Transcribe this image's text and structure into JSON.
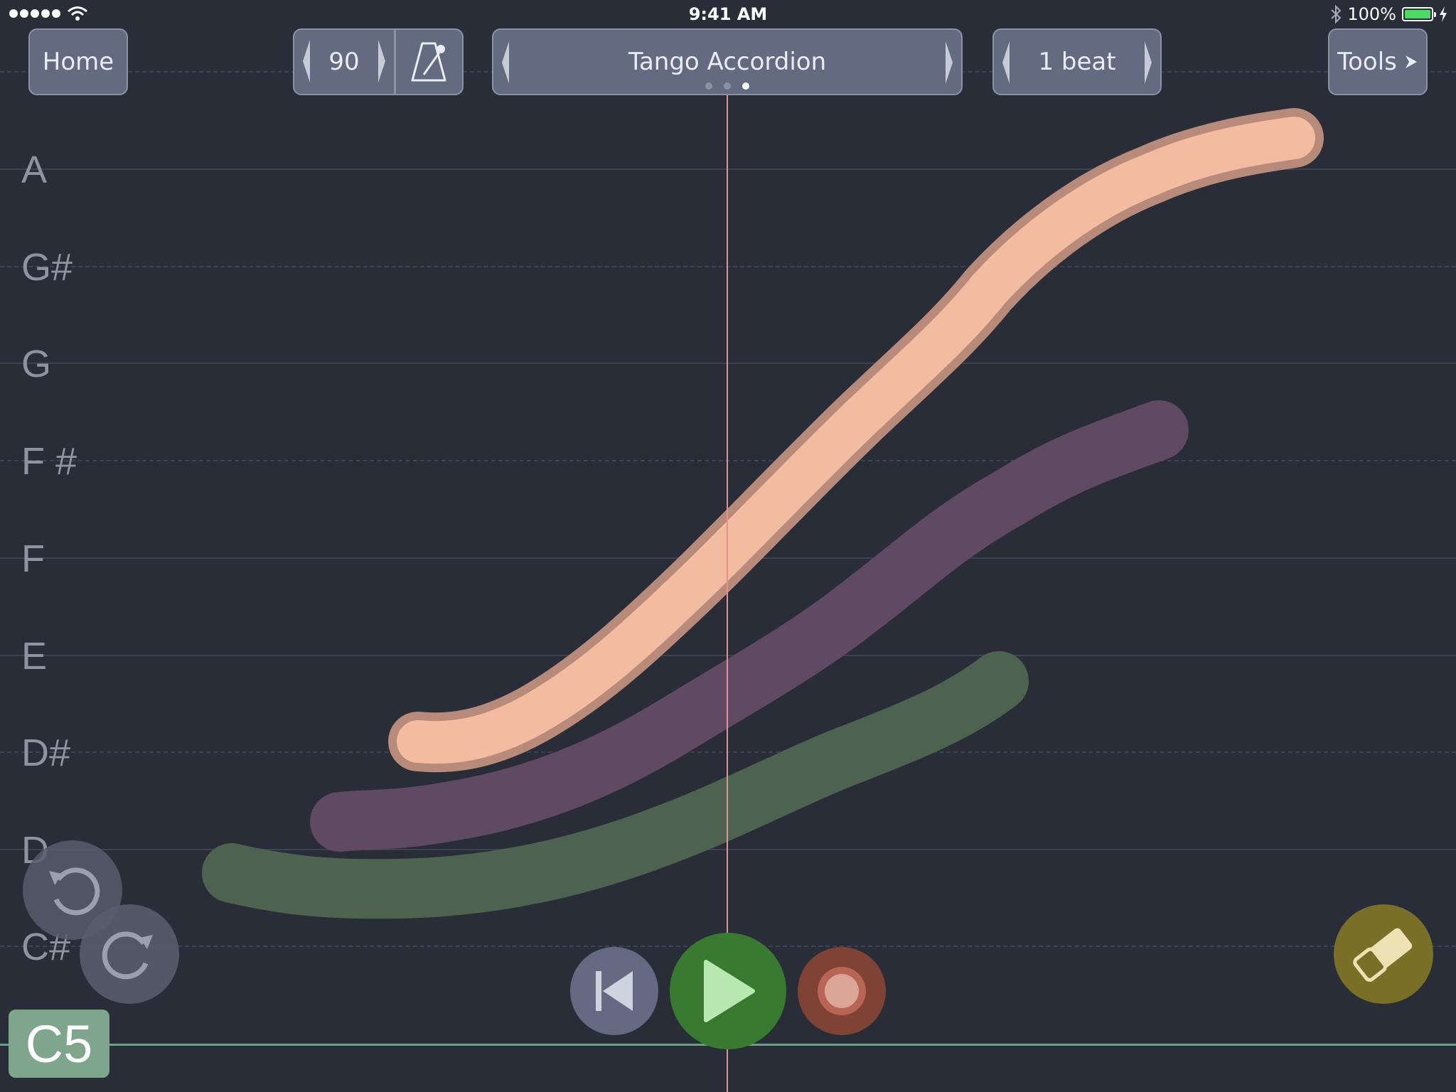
{
  "status_bar": {
    "time": "9:41 AM",
    "battery": "100%"
  },
  "toolbar": {
    "home_label": "Home",
    "tempo_value": "90",
    "instrument_name": "Tango Accordion",
    "beat_value": "1 beat",
    "tools_label": "Tools",
    "instrument_page_count": 3,
    "instrument_page_active": 3
  },
  "note_axis": {
    "labels": [
      "A",
      "G#",
      "G",
      "F #",
      "F",
      "E",
      "D#",
      "D",
      "C#"
    ]
  },
  "current_note": "C5",
  "strokes": [
    {
      "name": "peach",
      "color": "#f3bba0",
      "outline": "#b88a79"
    },
    {
      "name": "purple",
      "color": "#5f4963"
    },
    {
      "name": "green",
      "color": "#4d624f"
    }
  ],
  "colors": {
    "background": "#282d38",
    "playhead": "#e8908f",
    "play_button": "#387b30",
    "record_button": "#7f4335",
    "eraser_button": "#7a6f27"
  }
}
